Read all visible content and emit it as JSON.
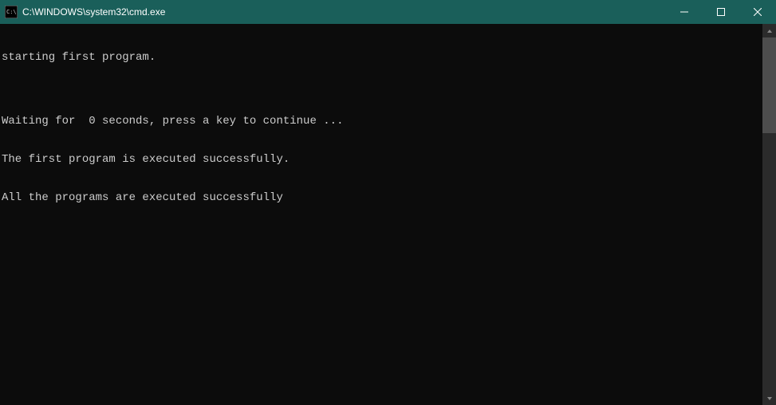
{
  "window": {
    "title": "C:\\WINDOWS\\system32\\cmd.exe"
  },
  "terminal": {
    "lines": [
      "starting first program.",
      "",
      "Waiting for  0 seconds, press a key to continue ...",
      "The first program is executed successfully.",
      "All the programs are executed successfully"
    ]
  }
}
